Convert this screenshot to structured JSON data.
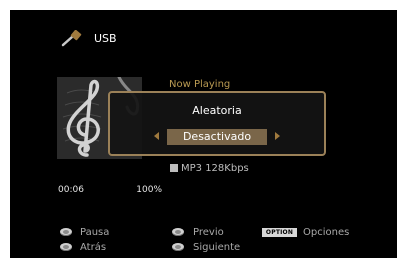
{
  "source": {
    "label": "USB",
    "icon": "usb-plug-icon"
  },
  "now_playing": {
    "header": "Now Playing",
    "format_icon": "file-format-icon",
    "format": "MP3 128Kbps",
    "elapsed": "00:06",
    "progress": "100%",
    "album_art_icon": "treble-clef-icon"
  },
  "popup": {
    "title": "Aleatoria",
    "value": "Desactivado"
  },
  "controls": {
    "pause": "Pausa",
    "back": "Atrás",
    "previous": "Previo",
    "next": "Siguiente",
    "option_button": "OPTION",
    "options": "Opciones"
  },
  "colors": {
    "background": "#000000",
    "accent": "#9b8158",
    "highlight": "#7a6649",
    "now_playing_text": "#b99a52"
  }
}
